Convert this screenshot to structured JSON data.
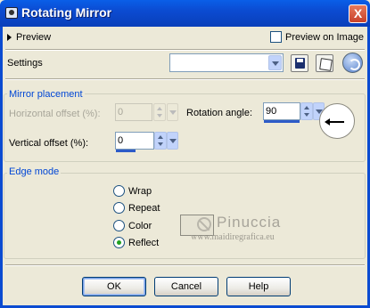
{
  "window": {
    "title": "Rotating Mirror",
    "close_label": "X"
  },
  "preview": {
    "toggle_label": "Preview",
    "on_image_label": "Preview on Image",
    "on_image_checked": false
  },
  "settings": {
    "label": "Settings",
    "value": ""
  },
  "mirror_placement": {
    "legend": "Mirror placement",
    "horizontal_offset_label": "Horizontal offset (%):",
    "horizontal_offset_value": "0",
    "horizontal_offset_enabled": false,
    "rotation_angle_label": "Rotation angle:",
    "rotation_angle_value": "90",
    "vertical_offset_label": "Vertical offset (%):",
    "vertical_offset_value": "0"
  },
  "edge_mode": {
    "legend": "Edge mode",
    "options": [
      {
        "label": "Wrap",
        "selected": false
      },
      {
        "label": "Repeat",
        "selected": false
      },
      {
        "label": "Color",
        "selected": false
      },
      {
        "label": "Reflect",
        "selected": true
      }
    ]
  },
  "watermark": {
    "name": "Pinuccia",
    "url": "www.maidiregrafica.eu"
  },
  "buttons": {
    "ok": "OK",
    "cancel": "Cancel",
    "help": "Help"
  },
  "icons": {
    "app": "mirror-app-icon",
    "save": "floppy-disk-icon",
    "random": "dice-icon",
    "reset": "reset-icon",
    "dial": "angle-dial-icon"
  },
  "colors": {
    "title_bar": "#0b4bd1",
    "window_bg": "#ece9d8",
    "legend": "#0046d5",
    "accent_bar": "#2d5bc8"
  }
}
